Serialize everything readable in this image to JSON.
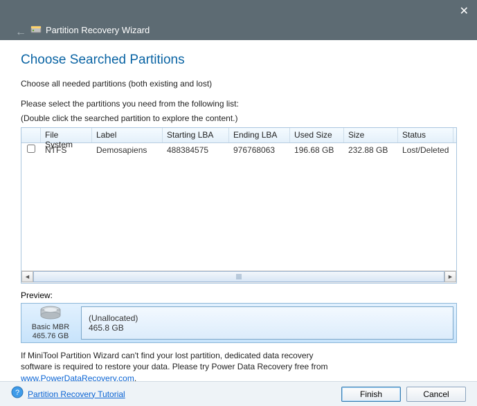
{
  "titlebar": {
    "title": "Partition Recovery Wizard"
  },
  "heading": "Choose Searched Partitions",
  "instruction1": "Choose all needed partitions (both existing and lost)",
  "instruction2a": "Please select the partitions you need from the following list:",
  "instruction2b": "(Double click the searched partition to explore the content.)",
  "table": {
    "headers": {
      "fs": "File System",
      "label": "Label",
      "slba": "Starting LBA",
      "elba": "Ending LBA",
      "used": "Used Size",
      "size": "Size",
      "status": "Status"
    },
    "row0": {
      "fs": "NTFS",
      "label": "Demosapiens",
      "slba": "488384575",
      "elba": "976768063",
      "used": "196.68 GB",
      "size": "232.88 GB",
      "status": "Lost/Deleted"
    }
  },
  "preview_label": "Preview:",
  "preview": {
    "disk_type": "Basic MBR",
    "disk_size": "465.76 GB",
    "part_name": "(Unallocated)",
    "part_size": "465.8 GB"
  },
  "note_line1": "If MiniTool Partition Wizard can't find your lost partition, dedicated data recovery",
  "note_line2": "software is required to restore your data. Please try Power Data Recovery free from",
  "note_link": "www.PowerDataRecovery.com",
  "note_period": ".",
  "footer": {
    "tutorial": "Partition Recovery Tutorial",
    "finish": "Finish",
    "cancel": "Cancel"
  }
}
